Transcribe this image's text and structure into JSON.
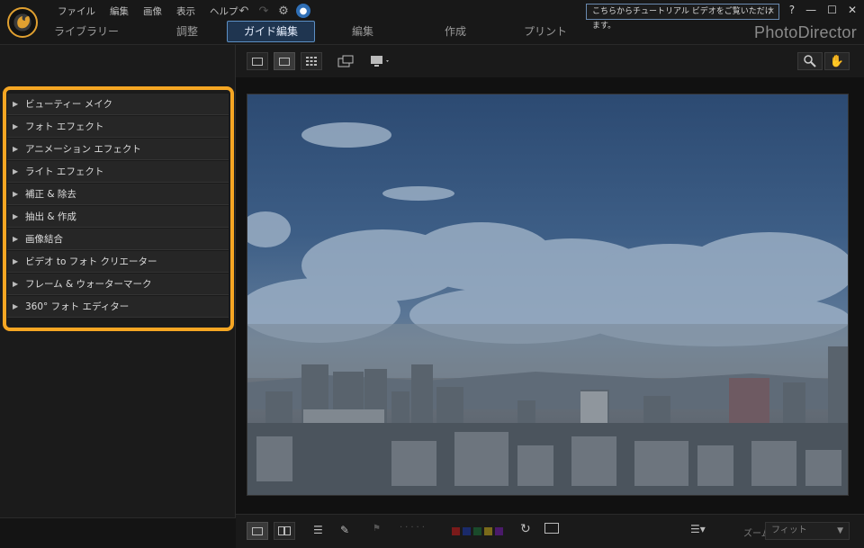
{
  "menu": [
    "ファイル",
    "編集",
    "画像",
    "表示",
    "ヘルプ"
  ],
  "tabs": [
    {
      "label": "ライブラリー",
      "active": false
    },
    {
      "label": "調整",
      "active": false
    },
    {
      "label": "ガイド編集",
      "active": true
    },
    {
      "label": "編集",
      "active": false
    },
    {
      "label": "作成",
      "active": false
    },
    {
      "label": "プリント",
      "active": false
    }
  ],
  "tutorial": {
    "text": "こちらからチュートリアル ビデオをご覧いただけます。",
    "close": "×"
  },
  "window_controls": [
    "?",
    "—",
    "☐",
    "✕"
  ],
  "brand": "PhotoDirector",
  "guided_edits": [
    "ビューティー メイク",
    "フォト エフェクト",
    "アニメーション エフェクト",
    "ライト エフェクト",
    "補正 & 除去",
    "抽出 & 作成",
    "画像結合",
    "ビデオ to フォト クリエーター",
    "フレーム & ウォーターマーク",
    "360° フォト エディター"
  ],
  "bottom": {
    "zoom_label": "ズーム:",
    "zoom_value": "フィット"
  },
  "colors": {
    "accent": "#f5a623",
    "active_tab": "#1f3550",
    "tab_border": "#5c8fc4"
  }
}
